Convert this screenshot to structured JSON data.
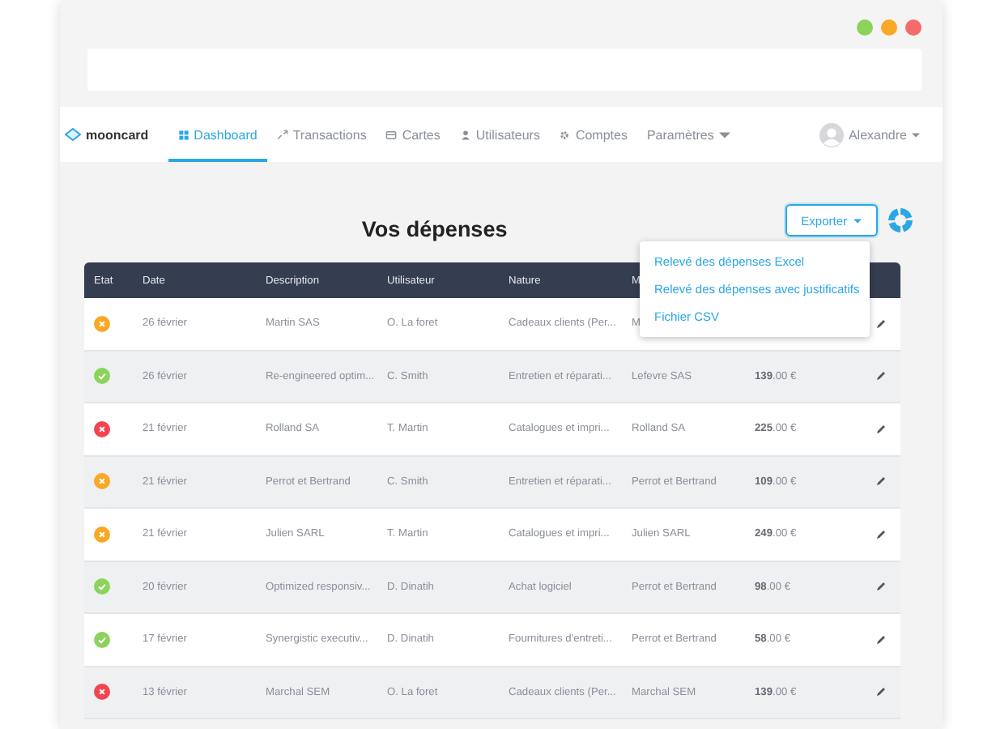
{
  "nav": {
    "brand": "mooncard",
    "items": [
      {
        "label": "Dashboard",
        "selected": true
      },
      {
        "label": "Transactions",
        "selected": false
      },
      {
        "label": "Cartes",
        "selected": false
      },
      {
        "label": "Utilisateurs",
        "selected": false
      },
      {
        "label": "Comptes",
        "selected": false
      },
      {
        "label": "Paramètres",
        "selected": false,
        "dropdown": true
      }
    ],
    "user": "Alexandre"
  },
  "title": "Vos dépenses",
  "export": {
    "label": "Exporter",
    "expanded": true,
    "menu": [
      "Relevé des dépenses Excel",
      "Relevé des dépenses avec justificatifs",
      "Fichier CSV"
    ]
  },
  "table": {
    "columns": [
      "Etat",
      "Date",
      "Description",
      "Utilisateur",
      "Nature",
      "M"
    ],
    "rows": [
      {
        "kind": "pending",
        "date": "26 février",
        "description": "Martin SAS",
        "user": "O. La foret",
        "nature": "Cadeaux clients (Per...",
        "supplier": "M"
      },
      {
        "kind": "approved",
        "date": "26 février",
        "description": "Re-engineered optim...",
        "user": "C. Smith",
        "nature": "Entretien et réparati...",
        "supplier": "Lefevre SAS",
        "amount": "**139**.00 €"
      },
      {
        "kind": "rejected",
        "date": "21 février",
        "description": "Rolland SA",
        "user": "T. Martin",
        "nature": "Catalogues et impri...",
        "supplier": "Rolland SA",
        "amount": "**225**.00 €"
      },
      {
        "kind": "pending",
        "date": "21 février",
        "description": "Perrot et Bertrand",
        "user": "C. Smith",
        "nature": "Entretien et réparati...",
        "supplier": "Perrot et Bertrand",
        "amount": "**109**.00 €"
      },
      {
        "kind": "pending",
        "date": "21 février",
        "description": "Julien SARL",
        "user": "T. Martin",
        "nature": "Catalogues et impri...",
        "supplier": "Julien SARL",
        "amount": "**249**.00 €"
      },
      {
        "kind": "approved",
        "date": "20 février",
        "description": "Optimized responsiv...",
        "user": "D. Dinatih",
        "nature": "Achat logiciel",
        "supplier": "Perrot et Bertrand",
        "amount": "**98**.00 €"
      },
      {
        "kind": "approved",
        "date": "17 février",
        "description": "Synergistic executiv...",
        "user": "D. Dinatih",
        "nature": "Fournitures d'entreti...",
        "supplier": "Perrot et Bertrand",
        "amount": "**58**.00 €"
      },
      {
        "kind": "rejected",
        "date": "13 février",
        "description": "Marchal SEM",
        "user": "O. La foret",
        "nature": "Cadeaux clients (Per...",
        "supplier": "Marchal SEM",
        "amount": "**139**.00 €"
      }
    ]
  }
}
